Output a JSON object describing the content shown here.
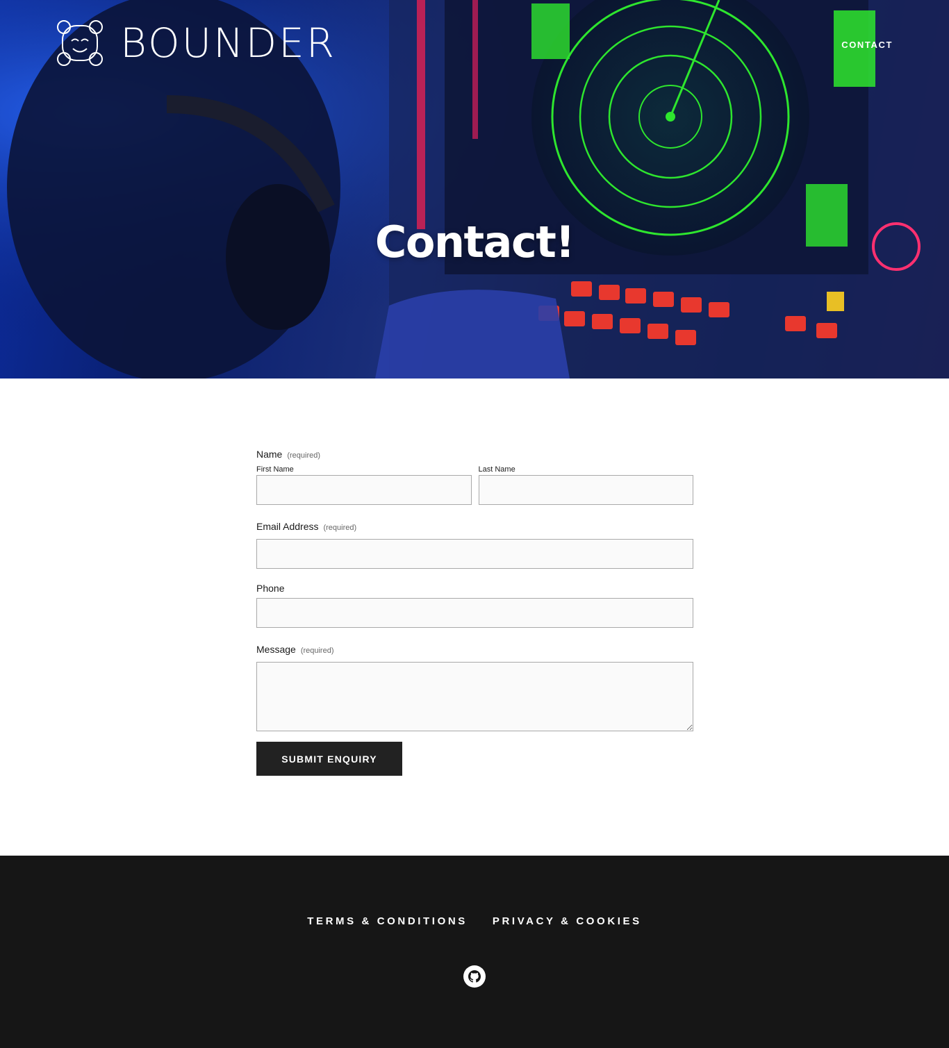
{
  "header": {
    "brand": "BOUNDER",
    "nav_contact": "CONTACT"
  },
  "hero": {
    "title": "Contact!"
  },
  "form": {
    "name_label": "Name",
    "name_required": "(required)",
    "first_name_label": "First Name",
    "first_name_value": "",
    "last_name_label": "Last Name",
    "last_name_value": "",
    "email_label": "Email Address",
    "email_required": "(required)",
    "email_value": "",
    "phone_label": "Phone",
    "phone_value": "",
    "message_label": "Message",
    "message_required": "(required)",
    "message_value": "",
    "submit_label": "SUBMIT ENQUIRY"
  },
  "footer": {
    "links": [
      "TERMS & CONDITIONS",
      "PRIVACY & COOKIES"
    ],
    "social_icon": "github-icon"
  },
  "colors": {
    "hero_blue": "#0c2c9e",
    "radar_green": "#2ee62e",
    "button_dark": "#222222",
    "footer_bg": "#161616"
  }
}
